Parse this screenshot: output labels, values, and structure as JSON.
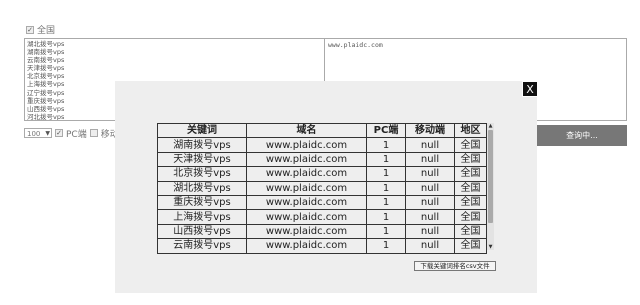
{
  "filters": {
    "nationwide_label": "全国",
    "nationwide_checked": true
  },
  "keywords_text": [
    "湖北拨号vps",
    "湖南拨号vps",
    "云南拨号vps",
    "天津拨号vps",
    "北京拨号vps",
    "上海拨号vps",
    "辽宁拨号vps",
    "重庆拨号vps",
    "山西拨号vps",
    "河北拨号vps"
  ],
  "site_text": "www.plaidc.com",
  "controls": {
    "count_value": "100",
    "pc_label": "PC端",
    "mobile_label": "移动端"
  },
  "query_button": "查询中...",
  "modal": {
    "close_label": "X",
    "columns": [
      "关键词",
      "域名",
      "PC端",
      "移动端",
      "地区"
    ],
    "rows": [
      [
        "湖南拨号vps",
        "www.plaidc.com",
        "1",
        "null",
        "全国"
      ],
      [
        "天津拨号vps",
        "www.plaidc.com",
        "1",
        "null",
        "全国"
      ],
      [
        "北京拨号vps",
        "www.plaidc.com",
        "1",
        "null",
        "全国"
      ],
      [
        "湖北拨号vps",
        "www.plaidc.com",
        "1",
        "null",
        "全国"
      ],
      [
        "重庆拨号vps",
        "www.plaidc.com",
        "1",
        "null",
        "全国"
      ],
      [
        "上海拨号vps",
        "www.plaidc.com",
        "1",
        "null",
        "全国"
      ],
      [
        "山西拨号vps",
        "www.plaidc.com",
        "1",
        "null",
        "全国"
      ],
      [
        "云南拨号vps",
        "www.plaidc.com",
        "1",
        "null",
        "全国"
      ]
    ],
    "download_label": "下载关键词排名csv文件"
  },
  "icons": {
    "checkbox": "check-icon",
    "dropdown": "chevron-down-icon",
    "scroll_up": "arrow-up-icon",
    "scroll_down": "arrow-down-icon"
  }
}
